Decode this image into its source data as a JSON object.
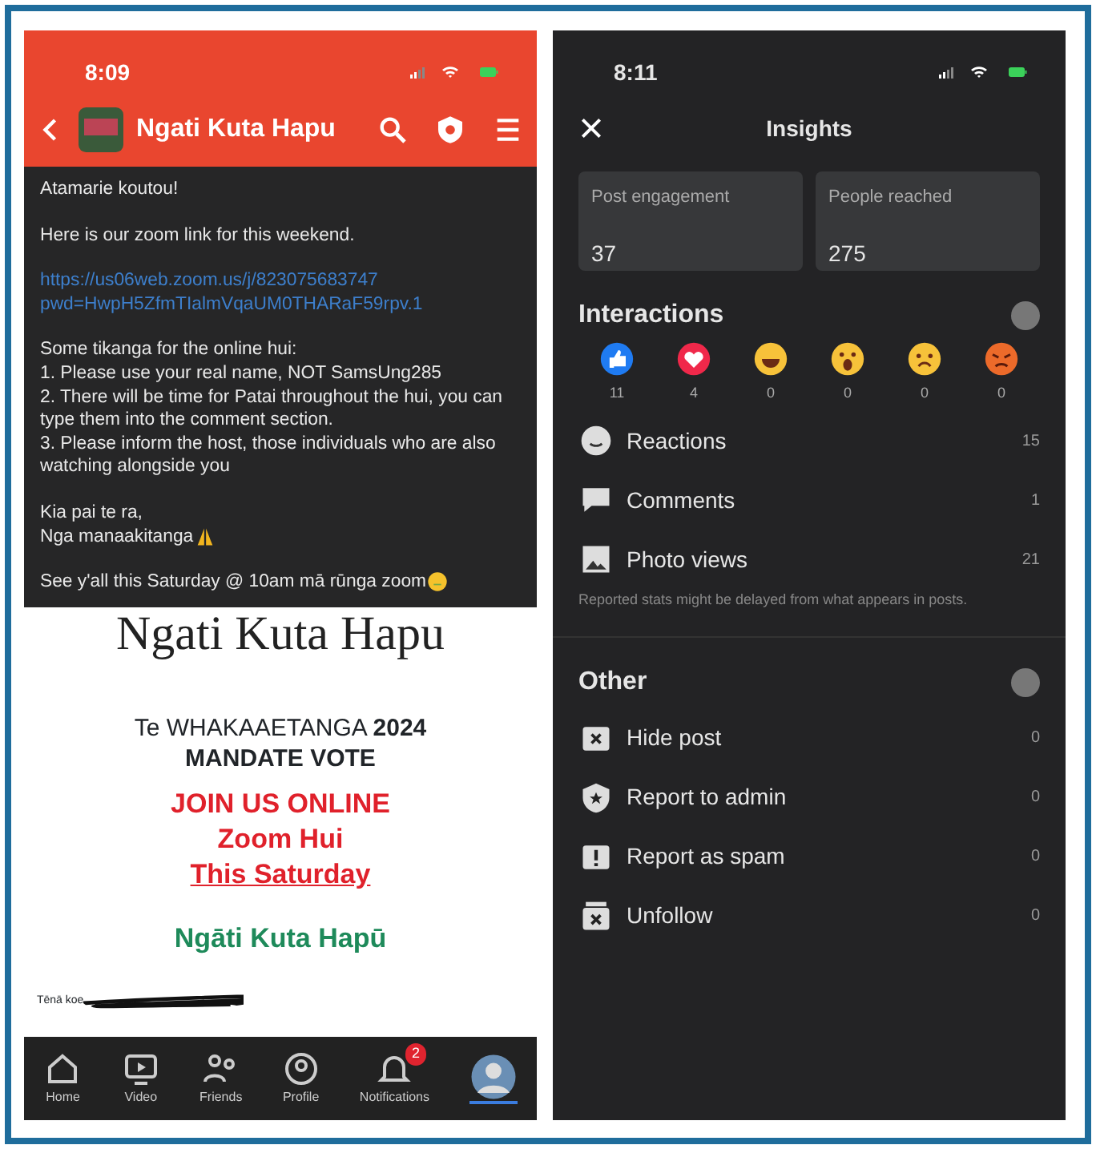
{
  "group_post_screen": {
    "status_bar": {
      "time": "8:09"
    },
    "header": {
      "title": "Ngati Kuta Hapu"
    },
    "message": [
      {
        "kind": "text",
        "lines": [
          "Atamarie koutou!"
        ]
      },
      {
        "kind": "text",
        "lines": [
          "Here is our zoom link for this weekend."
        ]
      },
      {
        "kind": "link",
        "lines": [
          "https://us06web.zoom.us/j/823075683747",
          "pwd=HwpH5ZfmTIalmVqaUM0THARaF59rpv.1"
        ]
      },
      {
        "kind": "text",
        "lines": [
          "Some tikanga for the online hui:",
          "1. Please use your real name, NOT SamsUng285",
          "2. There will be time for Patai throughout the hui, you can type them into the comment section.",
          "3. Please inform the host, those individuals who are also watching alongside you"
        ]
      },
      {
        "kind": "prayer",
        "lines": [
          "Kia pai te ra,",
          "Nga manaakitanga"
        ]
      },
      {
        "kind": "smiley",
        "lines": [
          "See y'all this Saturday @ 10am mā rūnga zoom"
        ]
      }
    ],
    "email_image": {
      "banner": "Ngati Kuta Hapu",
      "title_lines": [
        "Te WHAKAAETANGA **2024**",
        "MANDATE VOTE"
      ],
      "call_lines": [
        "JOIN US ONLINE",
        "Zoom Hui",
        "This Saturday"
      ],
      "org": "Ngāti Kuta Hapū",
      "greeting": "Tēnā koe"
    },
    "tab_bar": [
      {
        "kind": "home",
        "label": "Home",
        "selected": false
      },
      {
        "kind": "video",
        "label": "Video",
        "selected": false
      },
      {
        "kind": "friends",
        "label": "Friends",
        "selected": false
      },
      {
        "kind": "profile",
        "label": "Profile",
        "selected": false
      },
      {
        "kind": "bell",
        "label": "Notifications",
        "badge": "2",
        "selected": false
      },
      {
        "kind": "avatar",
        "selected": true
      }
    ]
  },
  "insights_screen": {
    "status_bar": {
      "time": "8:11"
    },
    "title": "Insights",
    "stats": [
      {
        "label": "Post engagement",
        "value": "37"
      },
      {
        "label": "People reached",
        "value": "275"
      }
    ],
    "interactions": {
      "title": "Interactions",
      "reactions": [
        {
          "kind": "like",
          "count": "11"
        },
        {
          "kind": "love",
          "count": "4"
        },
        {
          "kind": "haha",
          "count": "0"
        },
        {
          "kind": "wow",
          "count": "0"
        },
        {
          "kind": "sad",
          "count": "0"
        },
        {
          "kind": "angry",
          "count": "0"
        }
      ],
      "rows": [
        {
          "kind": "smile",
          "label": "Reactions",
          "value": "15"
        },
        {
          "kind": "comment",
          "label": "Comments",
          "value": "1"
        },
        {
          "kind": "photo",
          "label": "Photo views",
          "value": "21"
        }
      ],
      "note": "Reported stats might be delayed from what appears in posts."
    },
    "other": {
      "title": "Other",
      "rows": [
        {
          "kind": "hide",
          "label": "Hide post",
          "value": "0"
        },
        {
          "kind": "shield",
          "label": "Report to admin",
          "value": "0"
        },
        {
          "kind": "alert",
          "label": "Report as spam",
          "value": "0"
        },
        {
          "kind": "unfollow",
          "label": "Unfollow",
          "value": "0"
        }
      ]
    }
  }
}
